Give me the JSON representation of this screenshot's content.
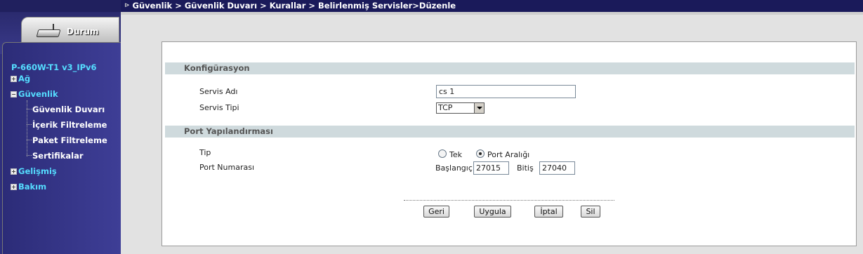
{
  "breadcrumb": "Güvenlik > Güvenlik Duvarı > Kurallar > Belirlenmiş Servisler>Düzenle",
  "sidebar": {
    "tab_label": "Durum",
    "device": "P-660W-T1 v3_IPv6",
    "items": {
      "ag": "Ağ",
      "guvenlik": "Güvenlik",
      "gelismis": "Gelişmiş",
      "bakim": "Bakım"
    },
    "sub_items": {
      "guvenlik_duvari": "Güvenlik Duvarı",
      "icerik": "İçerik Filtreleme",
      "paket": "Paket Filtreleme",
      "sertifikalar": "Sertifikalar"
    }
  },
  "config": {
    "section_title": "Konfigürasyon",
    "service_name_label": "Servis Adı",
    "service_name_value": "cs 1",
    "service_type_label": "Servis Tipi",
    "service_type_value": "TCP"
  },
  "port": {
    "section_title": "Port Yapılandırması",
    "type_label": "Tip",
    "single_label": "Tek",
    "range_label": "Port Aralığı",
    "selected": "range",
    "port_number_label": "Port Numarası",
    "start_label": "Başlangıç",
    "start_value": "27015",
    "end_label": "Bitiş",
    "end_value": "27040"
  },
  "buttons": {
    "back": "Geri",
    "apply": "Uygula",
    "cancel": "İptal",
    "delete": "Sil"
  }
}
